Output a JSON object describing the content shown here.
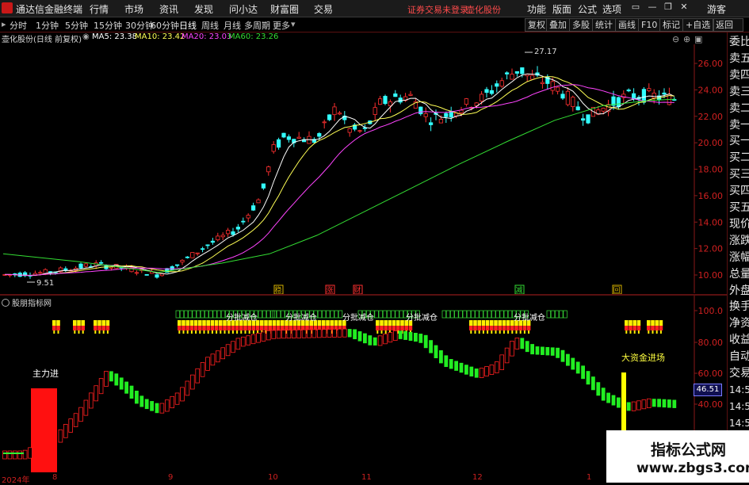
{
  "titlebar": {
    "app_title": "通达信金融终端",
    "menus": [
      "行情",
      "市场",
      "资讯",
      "发现",
      "问小达",
      "财富圈",
      "交易"
    ],
    "login_status": "证券交易未登录",
    "stock_name": "壶化股份",
    "right_menus": [
      "功能",
      "版面",
      "公式",
      "选项"
    ],
    "guest": "游客"
  },
  "toolbar": {
    "periods": [
      "分时",
      "1分钟",
      "5分钟",
      "15分钟",
      "30分钟",
      "60分钟",
      "日线",
      "周线",
      "月线",
      "多周期",
      "更多"
    ],
    "active_period": "日线",
    "right_buttons": [
      "复权",
      "叠加",
      "多股",
      "统计",
      "画线",
      "F10",
      "标记",
      "+自选",
      "返回"
    ]
  },
  "chart_legend": {
    "name": "壶化股份(日线 前复权)",
    "ma5": "MA5: 23.38",
    "ma10": "MA10: 23.42",
    "ma20": "MA20: 23.03",
    "ma60": "MA60: 23.26"
  },
  "colors": {
    "ma5": "#ffffff",
    "ma10": "#ffff55",
    "ma20": "#ff44ff",
    "ma60": "#33dd33",
    "up": "#ff3030",
    "down": "#33ffff"
  },
  "sidebar": [
    "委比",
    "卖五",
    "卖四",
    "卖三",
    "卖二",
    "卖一",
    "买一",
    "买二",
    "买三",
    "买四",
    "买五",
    "现价",
    "涨跌",
    "涨幅",
    "总量",
    "外盘",
    "换手",
    "净资",
    "收益",
    "自动",
    "交易",
    "14:55",
    "14:56",
    "14:56",
    "14:56",
    "14:56",
    "14:56"
  ],
  "price_axis": [
    "26.00",
    "24.00",
    "22.00",
    "20.00",
    "18.00",
    "16.00",
    "14.00",
    "12.00",
    "10.00"
  ],
  "price_labels": {
    "high": "27.17",
    "low": "9.51"
  },
  "event_markers": [
    "稳",
    "涨",
    "财",
    "减",
    "回"
  ],
  "indicator": {
    "title": "股朋指标网",
    "axis": [
      "100.0",
      "80.00",
      "60.00",
      "40.00"
    ],
    "current_value": "46.51",
    "labels": {
      "main_in": "主力进",
      "big_money": "大资金进场",
      "reduce": "分批减仓"
    }
  },
  "date_axis": [
    "2024年",
    "8",
    "9",
    "10",
    "11",
    "12",
    "1"
  ],
  "watermark": {
    "line1": "指标公式网",
    "line2": "www.zbgs3.com"
  }
}
